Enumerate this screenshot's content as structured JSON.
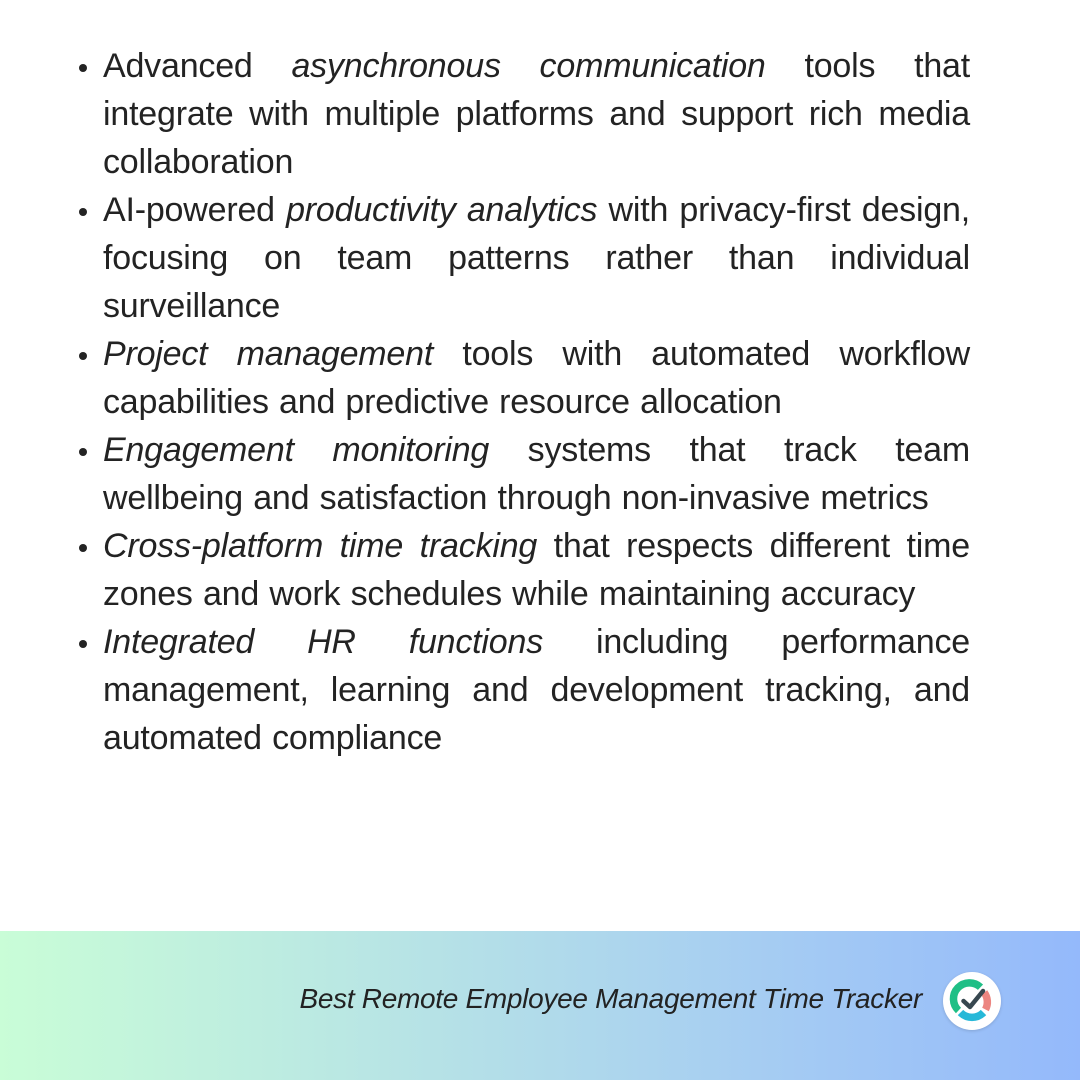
{
  "features": [
    {
      "lead": "Advanced ",
      "emphasis": "asynchronous communication",
      "text": " tools that integrate with multiple platforms and support rich media collaboration"
    },
    {
      "lead": "AI-powered ",
      "emphasis": "productivity analytics",
      "text": " with privacy-first design, focusing on team patterns rather than individual surveillance"
    },
    {
      "lead": "",
      "emphasis": "Project management",
      "text": " tools with automated workflow capabilities and predictive resource allocation"
    },
    {
      "lead": "",
      "emphasis": "Engagement monitoring",
      "text": " systems that track team wellbeing and satisfaction through non-invasive metrics"
    },
    {
      "lead": "",
      "emphasis": "Cross-platform time tracking",
      "text": " that respects different time zones and work schedules while maintaining accuracy"
    },
    {
      "lead": "",
      "emphasis": "Integrated HR functions",
      "text": " including performance management, learning and development tracking, and automated compliance"
    }
  ],
  "footer": {
    "tagline": "Best Remote Employee Management Time Tracker",
    "logo_icon": "time-tracker-gauge-check-icon"
  },
  "colors": {
    "text": "#232323",
    "gradient_start": "#c9fdd7",
    "gradient_end": "#94b9fb",
    "logo_green": "#1fbf86",
    "logo_red": "#ec8580",
    "logo_cyan": "#27b8d8",
    "logo_check": "#37474f"
  }
}
